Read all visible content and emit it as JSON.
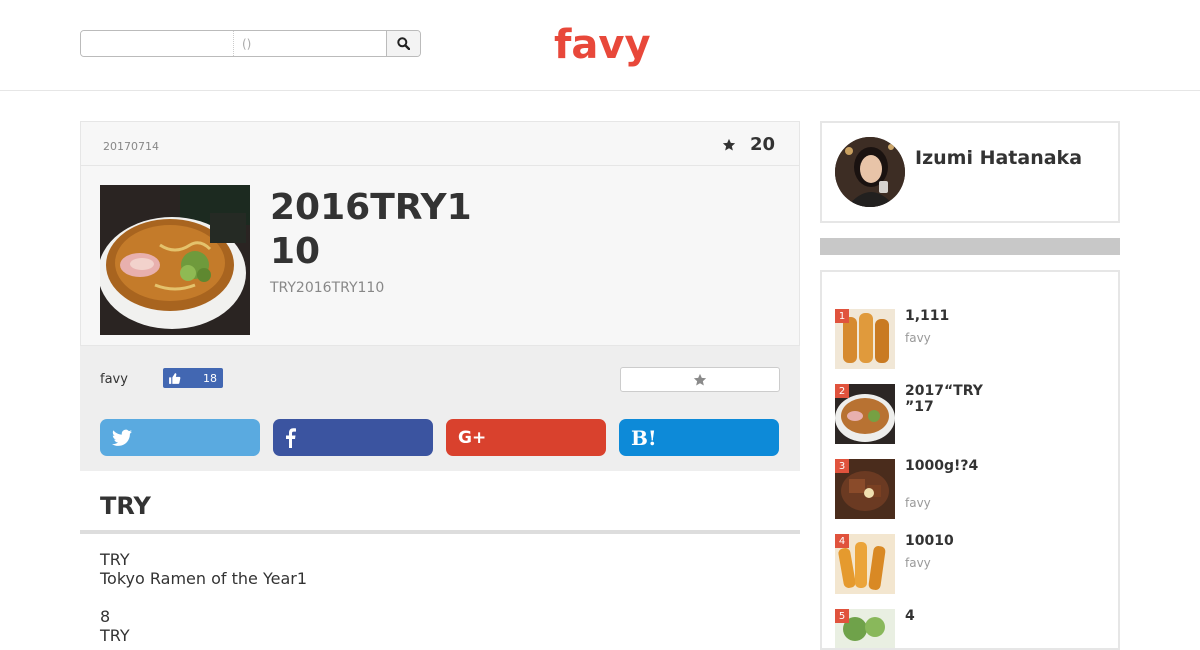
{
  "header": {
    "search": {
      "keyword_value": "",
      "area_placeholder": "()",
      "button_icon": "search-icon"
    },
    "logo": "favy",
    "logo_color": "#e8483a"
  },
  "article": {
    "date": "20170714",
    "favorite_count": "20",
    "title_line1": "2016TRY1",
    "title_line2": "10",
    "subtitle": "TRY2016TRY110",
    "source": "favy",
    "like_count": "18",
    "share": {
      "twitter_icon": "twitter-icon",
      "facebook_icon": "facebook-icon",
      "google_label": "G+",
      "hatena_label": "B!"
    },
    "section_heading": "TRY",
    "body_lines": [
      "TRY",
      "Tokyo Ramen of the Year1",
      "",
      "8",
      "TRY"
    ]
  },
  "sidebar": {
    "author_name": "Izumi Hatanaka",
    "ranking": [
      {
        "rank": "1",
        "title": "1,111",
        "source": "favy"
      },
      {
        "rank": "2",
        "title_line1": "2017“TRY",
        "title_line2": "”17",
        "source": ""
      },
      {
        "rank": "3",
        "title": "1000g!?4",
        "source": "favy"
      },
      {
        "rank": "4",
        "title": "10010",
        "source": "favy"
      },
      {
        "rank": "5",
        "title": "4",
        "source": ""
      }
    ]
  },
  "colors": {
    "accent": "#e8483a",
    "twitter": "#5aaae0",
    "facebook": "#3b54a0",
    "google": "#d9412d",
    "hatena": "#0d8ad8",
    "like": "#4267b2"
  }
}
